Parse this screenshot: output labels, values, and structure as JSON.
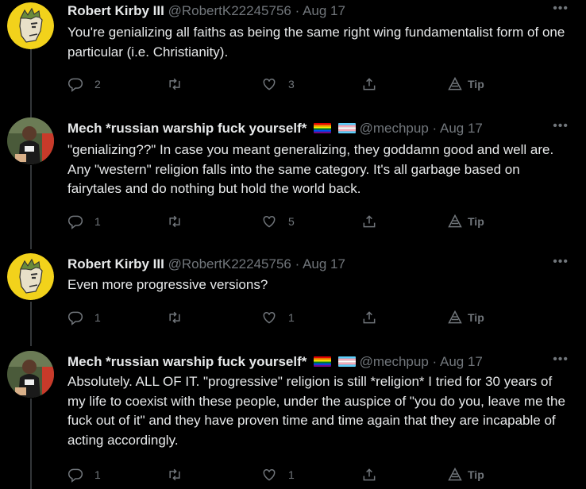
{
  "tweets": [
    {
      "name": "Robert Kirby III",
      "handle": "@RobertK22245756",
      "date": "Aug 17",
      "text": "You're genializing all faiths as being the same right wing fundamentalist form of one particular (i.e. Christianity).",
      "replies": "2",
      "retweets": "",
      "likes": "3",
      "tip": "Tip",
      "avatar": "cartoon-avatar"
    },
    {
      "name": "Mech *russian warship fuck yourself*",
      "handle": "@mechpup",
      "date": "Aug 17",
      "text": "\"genializing??\" In case you meant generalizing, they goddamn good and well are.  Any \"western\" religion falls into the same category. It's all garbage based on fairytales and do nothing but hold the world back.",
      "replies": "1",
      "retweets": "",
      "likes": "5",
      "tip": "Tip",
      "avatar": "photo-avatar"
    },
    {
      "name": "Robert Kirby III",
      "handle": "@RobertK22245756",
      "date": "Aug 17",
      "text": "Even more progressive versions?",
      "replies": "1",
      "retweets": "",
      "likes": "1",
      "tip": "Tip",
      "avatar": "cartoon-avatar"
    },
    {
      "name": "Mech *russian warship fuck yourself*",
      "handle": "@mechpup",
      "date": "Aug 17",
      "text": "Absolutely. ALL OF IT. \"progressive\" religion is still *religion*  I tried for 30 years of my life to coexist with these people, under the auspice of \"you do you, leave me the fuck out of it\" and they have proven time and time again that they are incapable of acting accordingly.",
      "replies": "1",
      "retweets": "",
      "likes": "1",
      "tip": "Tip",
      "avatar": "photo-avatar"
    }
  ],
  "icons": {
    "reply": "reply-icon",
    "retweet": "retweet-icon",
    "like": "like-icon",
    "share": "share-icon",
    "tip": "tip-icon",
    "more": "more-icon",
    "flags": [
      "rainbow-flag-icon",
      "trans-flag-icon"
    ]
  },
  "colors": {
    "background": "#000000",
    "text": "#e7e9ea",
    "muted": "#71767b",
    "avatar_yellow": "#f2d21b"
  }
}
